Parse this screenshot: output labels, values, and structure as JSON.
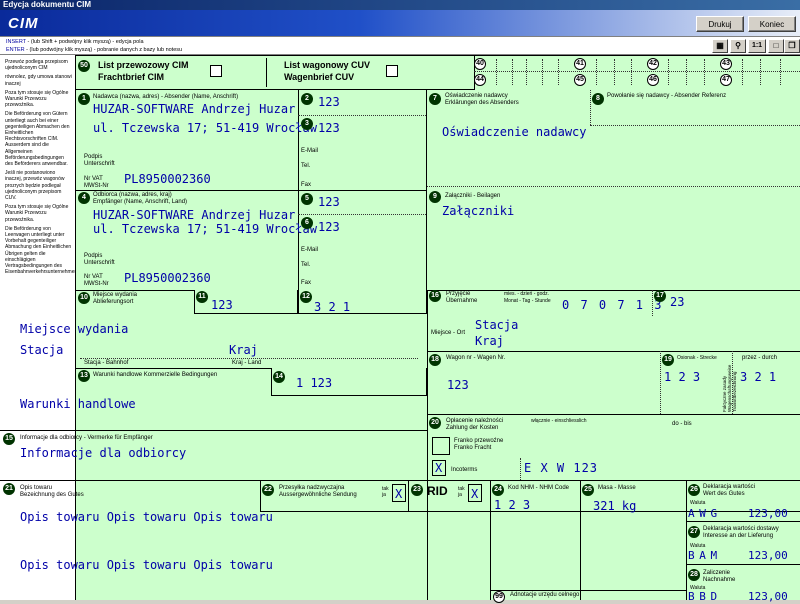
{
  "window": {
    "title": "Edycja dokumentu CIM",
    "logo": "CIM",
    "print_label": "Drukuj",
    "close_label": "Koniec"
  },
  "infobar": {
    "line1_key": "INSERT",
    "line1_text": "- (lub Shift + podwójny klik myszą) - edycja pola",
    "line2_key": "ENTER",
    "line2_text": "- (lub podwójny klik myszą) - pobranie danych z bazy lub notesu",
    "zoom_label": "1:1"
  },
  "sidebar": {
    "paragraphs": [
      "Przewóz podlega przepisom ujednoliconym CIM",
      "równolez, gdy umowa stanowi inaczej",
      "Poza tym stosuje się Ogólne Warunki Przewozu przewoźnika.",
      "Die Beförderung von Gütern unterliegt auch bei einer gegenteiligen Abmachen den Einheitlichen Rechtsvorschriften CIM. Ausserdem sind die Allgemeinen Beförderungsbedingungen des Beförderers anwendbar.",
      "Jeśli nie postanowiono inaczej, przewóz wagonów prozrych będzie podlegał ujednoliconym przepisom CUV.",
      "Poza tym stosuje się Ogólne Warunki Przewozu przewoźnika.",
      "Die Beförderung von Leerwagen unterliegt unter Vorbehalt gegenteiliger Abmachung den Einheitlichen Übrigen gelten die einschlägigen Vertragsbedingungen des Eisenbahnverkehrsunternehmens."
    ]
  },
  "form": {
    "top": {
      "badge": "50",
      "cim_title": "List przewozowy CIM",
      "cim_sub": "Frachtbrief CIM",
      "cuv_title": "List wagonowy CUV",
      "cuv_sub": "Wagenbrief CUV",
      "numbers": [
        "40",
        "41",
        "42",
        "43",
        "44",
        "45",
        "46",
        "47"
      ]
    },
    "f1": {
      "badge": "1",
      "label1": "Nadawca (nazwa, adres) - Absender (Name, Anschrift)",
      "name": "HUZAR-SOFTWARE Andrzej Huzar",
      "address": "ul. Tczewska 17; 51-419 Wrocław",
      "sig1": "Podpis",
      "sig2": "Unterschrift",
      "vat1": "Nr VAT",
      "vat2": "MWSt-Nr",
      "vat_value": "PL8950002360"
    },
    "f2": {
      "badge": "2",
      "value": "123"
    },
    "f3": {
      "badge": "3",
      "value": "123"
    },
    "contact": {
      "email": "E-Mail",
      "tel": "Tel.",
      "fax": "Fax"
    },
    "f4": {
      "badge": "4",
      "label1": "Odbiorca (nazwa, adres, kraj)",
      "label2": "Empfänger (Name, Anschrift, Land)",
      "name": "HUZAR-SOFTWARE Andrzej Huzar",
      "address": "ul. Tczewska 17; 51-419 Wrocław",
      "sig1": "Podpis",
      "sig2": "Unterschrift",
      "vat1": "Nr VAT",
      "vat2": "MWSt-Nr",
      "vat_value": "PL8950002360"
    },
    "f5": {
      "badge": "5",
      "value": "123"
    },
    "f6": {
      "badge": "6",
      "value": "123"
    },
    "f7": {
      "badge": "7",
      "label1": "Oświadczenie nadawcy",
      "label2": "Erklärungen des Absenders",
      "value": "Oświadczenie nadawcy"
    },
    "f8": {
      "badge": "8",
      "label": "Powołanie się nadawcy - Absender Referenz"
    },
    "f9": {
      "badge": "9",
      "label": "Załączniki - Beilagen",
      "value": "Załączniki"
    },
    "f10": {
      "badge": "10",
      "label1": "Miejsce wydania",
      "label2": "Ablieferungsort",
      "place": "Miejsce wydania",
      "station": "Stacja",
      "country": "Kraj",
      "station_label": "Stacja - Bahnhof",
      "country_label": "Kraj - Land"
    },
    "f11": {
      "badge": "11",
      "value": "123"
    },
    "f12": {
      "badge": "12",
      "value": "3 2 1"
    },
    "f13": {
      "badge": "13",
      "label": "Warunki handlowe Kommerzielle Bedingungen",
      "value": "Warunki handlowe"
    },
    "f14": {
      "badge": "14",
      "value": "1  123"
    },
    "f15": {
      "badge": "15",
      "label": "Informacje dla odbiorcy - Vermerke für Empfänger",
      "value": "Informacje dla odbiorcy"
    },
    "f16": {
      "badge": "16",
      "label1": "Przyjęcie",
      "label2": "Übernahme",
      "dm1": "mies. - dzień - godz.",
      "dm2": "Monat - Tag - Stunde",
      "datetime": "0 7 0 7 1 3",
      "place_label": "Miejsce - Ort",
      "station": "Stacja",
      "country": "Kraj"
    },
    "f17": {
      "badge": "17",
      "value": "23"
    },
    "f18": {
      "badge": "18",
      "label": "Wagon nr - Wagen Nr.",
      "value": "123"
    },
    "f19": {
      "badge": "19",
      "label": "Osionak - Strecke",
      "vertical": "Faktyczne zasady Wagenschaftungsweise Transittbezeichnung",
      "label_right": "przez - durch",
      "value1": "1 2 3",
      "value2": "3 2 1"
    },
    "f20": {
      "badge": "20",
      "label1": "Opłacenie należności",
      "label2": "Zahlung der Kosten",
      "col_incl": "włącznie - einschliesslich",
      "col_to": "do - bis",
      "franko1": "Franko przewoźne",
      "franko2": "Franko Fracht",
      "mark": "X",
      "incoterms_label": "Incoterms",
      "incoterms_value": "E X W  123"
    },
    "f21": {
      "badge": "21",
      "label1": "Opis towaru",
      "label2": "Bezeichnung des Gutes",
      "line1": "Opis towaru Opis towaru  Opis towaru",
      "line2": "Opis towaru  Opis towaru  Opis towaru"
    },
    "f22": {
      "badge": "22",
      "label1": "Przesyłka nadzwyczajna",
      "label2": "Aussergewöhnliche Sendung",
      "tak": "tak",
      "ja": "ja",
      "mark": "X"
    },
    "f23": {
      "badge": "23",
      "rid": "RID",
      "tak": "tak",
      "ja": "ja",
      "mark": "X"
    },
    "f24": {
      "badge": "24",
      "label": "Kod NHM - NHM Code",
      "value": "1 2 3"
    },
    "f25": {
      "badge": "25",
      "label": "Masa - Masse",
      "value": "321 kg"
    },
    "f26": {
      "badge": "26",
      "label1": "Deklaracja wartości",
      "label2": "Wert des Gutes",
      "curr_label": "Waluta",
      "currency": "A W G",
      "amount": "123,00"
    },
    "f27": {
      "badge": "27",
      "label1": "Deklaracja wartości dostawy",
      "label2": "Interesse an der Lieferung",
      "curr_label": "Waluta",
      "currency": "B A M",
      "amount": "123,00"
    },
    "f28": {
      "badge": "28",
      "label1": "Zaliczenie",
      "label2": "Nachnahme",
      "curr_label": "Waluta",
      "currency": "B B D",
      "amount": "123,00"
    },
    "f99": {
      "badge": "99",
      "label": "Adnotacje urzędu celnego"
    }
  }
}
